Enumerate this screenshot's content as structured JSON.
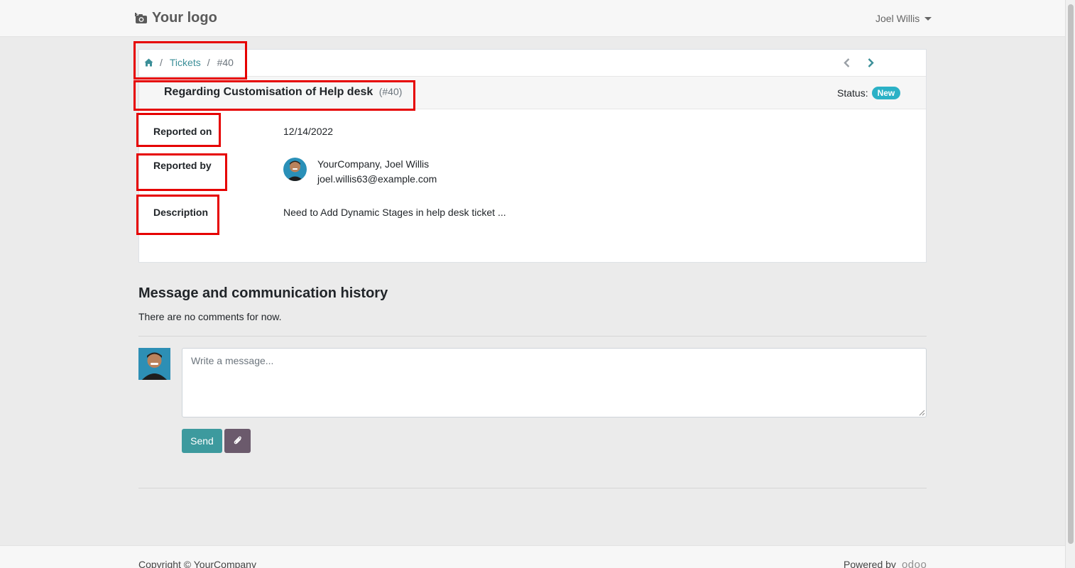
{
  "navbar": {
    "logo_text": "Your logo",
    "logo_icon": "camera-icon",
    "user_name": "Joel Willis"
  },
  "breadcrumb": {
    "home_icon": "home-icon",
    "sep1": "/",
    "tickets_label": "Tickets",
    "sep2": "/",
    "current": "#40"
  },
  "pager": {
    "prev_icon": "chevron-left-icon",
    "next_icon": "chevron-right-icon"
  },
  "ticket": {
    "title": "Regarding Customisation of Help desk",
    "ref": "(#40)",
    "status_label": "Status:",
    "status_value": "New",
    "status_color": "#2bb1c6"
  },
  "fields": {
    "reported_on_label": "Reported on",
    "reported_on_value": "12/14/2022",
    "reported_by_label": "Reported by",
    "reporter_name": "YourCompany, Joel Willis",
    "reporter_email": "joel.willis63@example.com",
    "description_label": "Description",
    "description_value": "Need to Add Dynamic Stages in help desk ticket ..."
  },
  "history": {
    "title": "Message and communication history",
    "empty_text": "There are no comments for now.",
    "message_placeholder": "Write a message...",
    "send_label": "Send",
    "attach_icon": "paperclip-icon"
  },
  "footer": {
    "copyright": "Copyright © YourCompany",
    "powered_by": "Powered by",
    "odoo": "odoo"
  },
  "colors": {
    "accent": "#3d9a9e",
    "link": "#3b8f98",
    "attach_button": "#6b5a6c",
    "highlight": "#e60000"
  }
}
